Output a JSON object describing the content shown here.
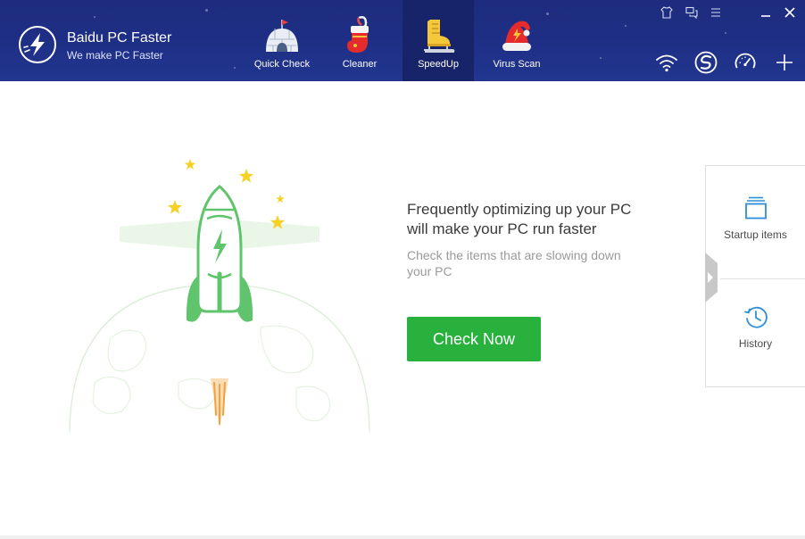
{
  "app": {
    "title": "Baidu PC Faster",
    "subtitle": "We make PC Faster"
  },
  "nav": {
    "tabs": [
      {
        "id": "quick-check",
        "label": "Quick Check",
        "icon": "igloo-icon",
        "active": false
      },
      {
        "id": "cleaner",
        "label": "Cleaner",
        "icon": "stocking-icon",
        "active": false
      },
      {
        "id": "speedup",
        "label": "SpeedUp",
        "icon": "skate-icon",
        "active": true
      },
      {
        "id": "virus-scan",
        "label": "Virus Scan",
        "icon": "santa-hat-icon",
        "active": false
      }
    ]
  },
  "window_controls": [
    "skin-icon",
    "feedback-icon",
    "menu-icon",
    "minimize-icon",
    "close-icon"
  ],
  "toolbar_icons": [
    "wifi-icon",
    "baidu-icon",
    "speedometer-icon",
    "plus-icon"
  ],
  "main": {
    "headline_line1": "Frequently optimizing up your PC",
    "headline_line2": "will make your PC run faster",
    "subline_line1": "Check the items that are slowing down",
    "subline_line2": "your PC",
    "check_now_label": "Check Now"
  },
  "side_panel": {
    "items": [
      {
        "id": "startup-items",
        "label": "Startup items",
        "icon": "startup-stack-icon"
      },
      {
        "id": "history",
        "label": "History",
        "icon": "history-clock-icon"
      }
    ]
  },
  "colors": {
    "header_bg": "#1e2f86",
    "active_tab_bg": "#17246a",
    "accent_green": "#29b13e",
    "rocket_green": "#5fc46b",
    "icon_blue": "#2d8fd9"
  }
}
